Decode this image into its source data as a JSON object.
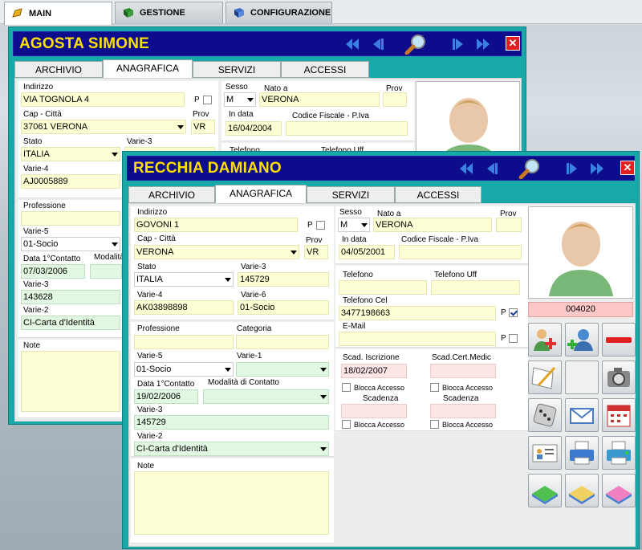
{
  "main_tabs": [
    {
      "label": "MAIN",
      "icon": "pencil-icon"
    },
    {
      "label": "GESTIONE",
      "icon": "book-icon"
    },
    {
      "label": "CONFIGURAZIONE",
      "icon": "wrench-icon"
    }
  ],
  "back_window": {
    "title": "AGOSTA SIMONE",
    "tabs": [
      "ARCHIVIO",
      "ANAGRAFICA",
      "SERVIZI",
      "ACCESSI"
    ],
    "labels": {
      "indirizzo": "Indirizzo",
      "p": "P",
      "cap_citta": "Cap - Città",
      "prov": "Prov",
      "stato": "Stato",
      "varie3": "Varie-3",
      "varie4": "Varie-4",
      "professione": "Professione",
      "varie5": "Varie-5",
      "data_contatto": "Data 1°Contatto",
      "modalita": "Modalità",
      "varie3b": "Varie-3",
      "varie2": "Varie-2",
      "note": "Note",
      "sesso": "Sesso",
      "nato_a": "Nato a",
      "prov2": "Prov",
      "in_data": "In data",
      "codice_fiscale": "Codice Fiscale - P.Iva",
      "telefono": "Telefono",
      "telefono_uff": "Telefono Uff"
    },
    "values": {
      "indirizzo": "VIA TOGNOLA 4",
      "cap_citta": "37061 VERONA",
      "prov": "VR",
      "stato": "ITALIA",
      "varie4": "AJ0005889",
      "varie5": "01-Socio",
      "data_contatto": "07/03/2006",
      "varie3b": "143628",
      "varie2": "CI-Carta d'Identità",
      "sesso": "M",
      "nato_a": "VERONA",
      "in_data": "16/04/2004"
    }
  },
  "front_window": {
    "title": "RECCHIA DAMIANO",
    "tabs": [
      "ARCHIVIO",
      "ANAGRAFICA",
      "SERVIZI",
      "ACCESSI"
    ],
    "labels": {
      "indirizzo": "Indirizzo",
      "p": "P",
      "cap_citta": "Cap - Città",
      "prov": "Prov",
      "stato": "Stato",
      "varie3": "Varie-3",
      "varie4": "Varie-4",
      "varie6": "Varie-6",
      "professione": "Professione",
      "categoria": "Categoria",
      "varie5": "Varie-5",
      "varie1": "Varie-1",
      "data_contatto": "Data 1°Contatto",
      "modalita": "Modalità di Contatto",
      "varie3b": "Varie-3",
      "varie2": "Varie-2",
      "note": "Note",
      "sesso": "Sesso",
      "nato_a": "Nato a",
      "prov2": "Prov",
      "in_data": "In data",
      "codice_fiscale": "Codice Fiscale - P.Iva",
      "telefono": "Telefono",
      "telefono_uff": "Telefono Uff",
      "telefono_cel": "Telefono Cel",
      "p2": "P",
      "email": "E-Mail",
      "p3": "P",
      "scad_iscrizione": "Scad. Iscrizione",
      "scad_cert": "Scad.Cert.Medic",
      "blocca1": "Blocca Accesso",
      "blocca2": "Blocca Accesso",
      "scadenza1": "Scadenza",
      "scadenza2": "Scadenza",
      "blocca3": "Blocca Accesso",
      "blocca4": "Blocca Accesso"
    },
    "values": {
      "indirizzo": "GOVONI 1",
      "cap_citta": "VERONA",
      "prov": "VR",
      "stato": "ITALIA",
      "varie3": "145729",
      "varie4": "AK03898898",
      "varie6": "01-Socio",
      "varie5": "01-Socio",
      "data_contatto": "19/02/2006",
      "varie3b": "145729",
      "varie2": "CI-Carta d'Identità",
      "sesso": "M",
      "nato_a": "VERONA",
      "in_data": "04/05/2001",
      "telefono_cel": "3477198663",
      "scad_iscrizione": "18/02/2007",
      "member_code": "004020"
    },
    "p_cel_checked": true,
    "action_buttons": [
      "edit-user-icon",
      "add-user-icon",
      "remove-icon",
      "notepad-icon",
      "blank-icon",
      "camera-icon",
      "dice-icon",
      "email-icon",
      "calendar-icon",
      "id-card-icon",
      "printer-icon",
      "printer-color-icon",
      "folder-green-icon",
      "folder-yellow-icon",
      "folder-pink-icon"
    ]
  }
}
